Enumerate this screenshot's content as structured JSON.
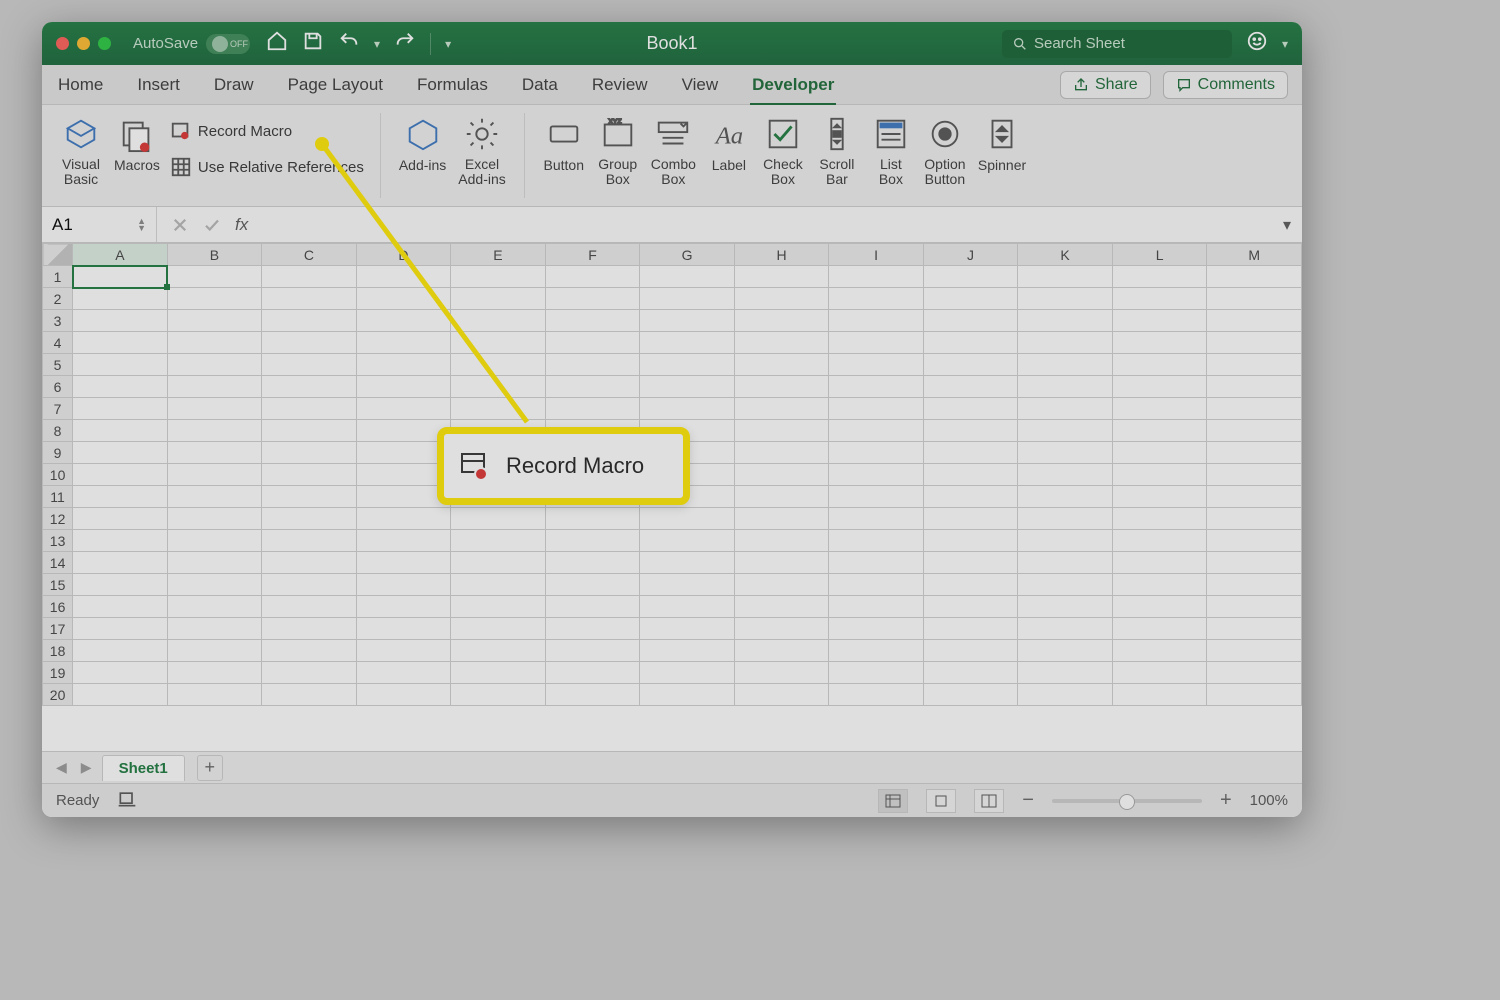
{
  "title": "Book1",
  "autosave": {
    "label": "AutoSave",
    "state": "OFF"
  },
  "search": {
    "placeholder": "Search Sheet"
  },
  "tabs": [
    "Home",
    "Insert",
    "Draw",
    "Page Layout",
    "Formulas",
    "Data",
    "Review",
    "View",
    "Developer"
  ],
  "activeTab": "Developer",
  "actions": {
    "share": "Share",
    "comments": "Comments"
  },
  "ribbon": {
    "visualBasic": "Visual\nBasic",
    "macros": "Macros",
    "recordMacro": "Record Macro",
    "useRelative": "Use Relative References",
    "addins": "Add-ins",
    "excelAddins": "Excel\nAdd-ins",
    "button": "Button",
    "groupBox": "Group\nBox",
    "comboBox": "Combo\nBox",
    "labelCtl": "Label",
    "checkBox": "Check\nBox",
    "scrollBar": "Scroll\nBar",
    "listBox": "List\nBox",
    "optionButton": "Option\nButton",
    "spinner": "Spinner"
  },
  "nameBox": "A1",
  "fxLabel": "fx",
  "columns": [
    "A",
    "B",
    "C",
    "D",
    "E",
    "F",
    "G",
    "H",
    "I",
    "J",
    "K",
    "L",
    "M"
  ],
  "rows": [
    1,
    2,
    3,
    4,
    5,
    6,
    7,
    8,
    9,
    10,
    11,
    12,
    13,
    14,
    15,
    16,
    17,
    18,
    19,
    20
  ],
  "sheetTab": "Sheet1",
  "status": {
    "ready": "Ready",
    "zoom": "100%"
  },
  "callout": "Record Macro"
}
